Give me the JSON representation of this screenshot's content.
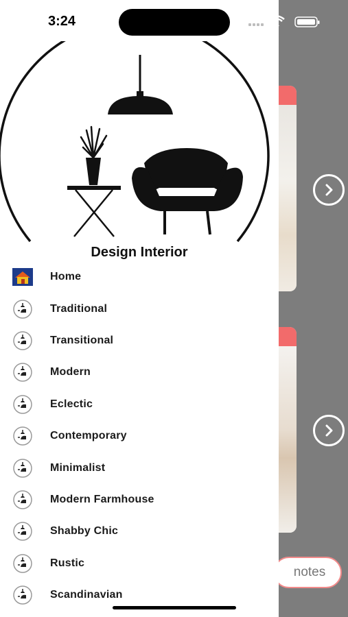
{
  "status_bar": {
    "time": "3:24"
  },
  "drawer": {
    "brand_title": "Design Interior",
    "menu_items": [
      {
        "label": "Home",
        "icon": "house-icon"
      },
      {
        "label": "Traditional",
        "icon": "interior-icon"
      },
      {
        "label": "Transitional",
        "icon": "interior-icon"
      },
      {
        "label": "Modern",
        "icon": "interior-icon"
      },
      {
        "label": "Eclectic",
        "icon": "interior-icon"
      },
      {
        "label": "Contemporary",
        "icon": "interior-icon"
      },
      {
        "label": "Minimalist",
        "icon": "interior-icon"
      },
      {
        "label": "Modern Farmhouse",
        "icon": "interior-icon"
      },
      {
        "label": "Shabby Chic",
        "icon": "interior-icon"
      },
      {
        "label": "Rustic",
        "icon": "interior-icon"
      },
      {
        "label": "Scandinavian",
        "icon": "interior-icon"
      }
    ]
  },
  "background_app": {
    "notes_label": "notes",
    "accent_color": "#f26b6b",
    "overlay_color": "#7d7d7d"
  }
}
